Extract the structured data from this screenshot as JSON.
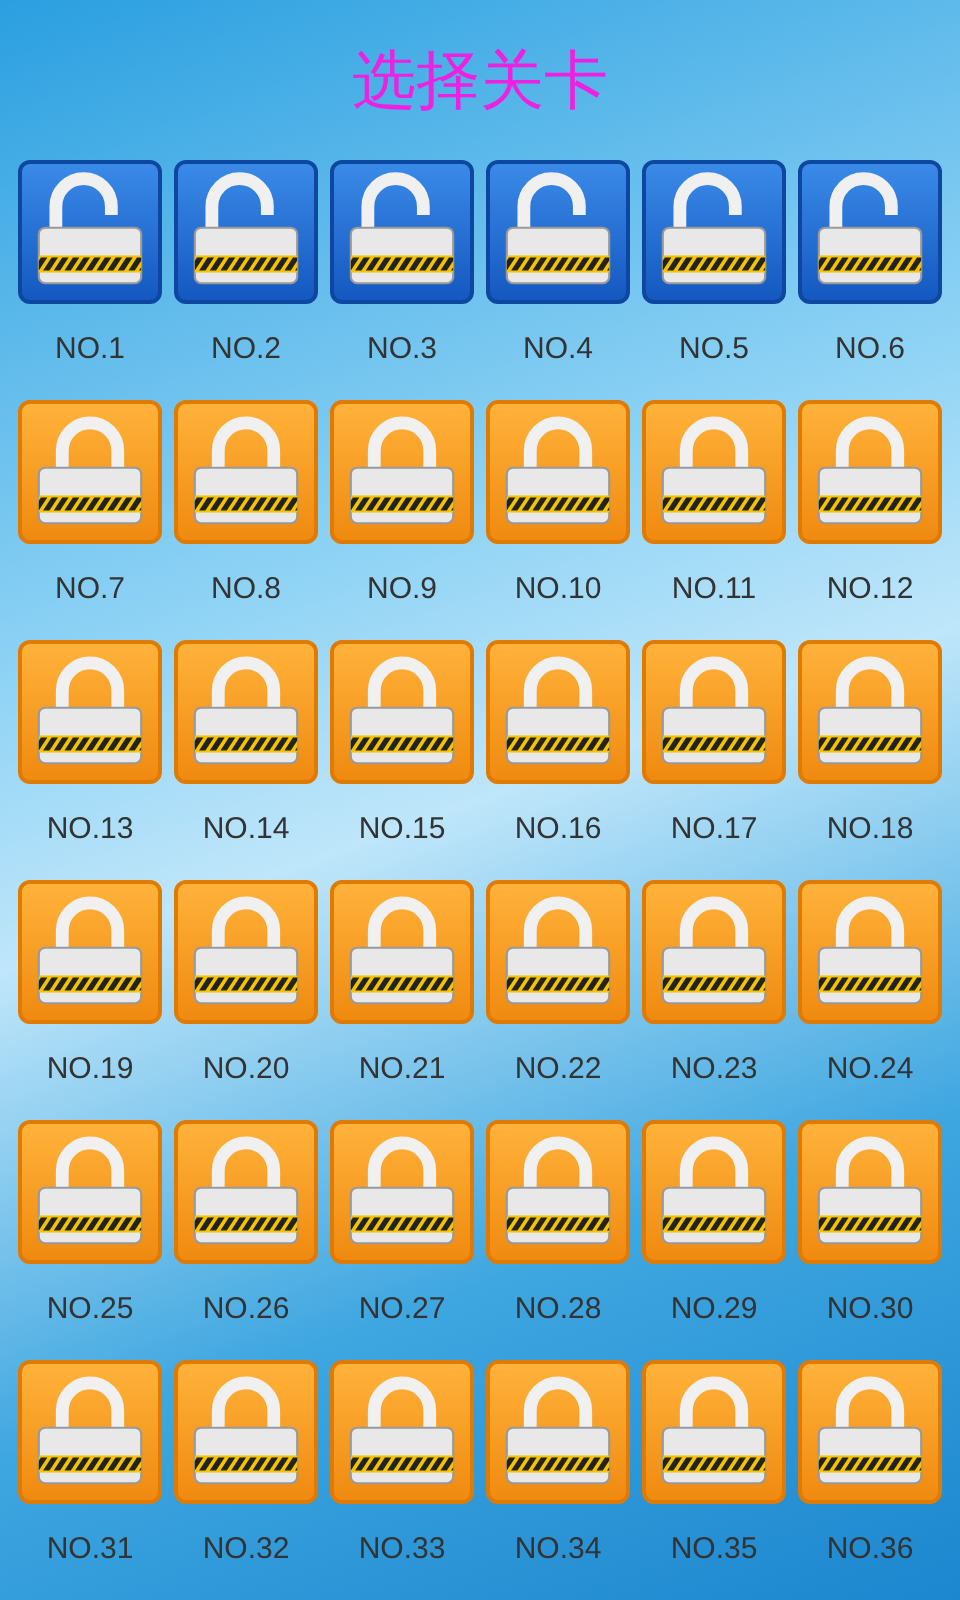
{
  "title": "选择关卡",
  "levels": [
    {
      "label": "NO.1",
      "locked": false
    },
    {
      "label": "NO.2",
      "locked": false
    },
    {
      "label": "NO.3",
      "locked": false
    },
    {
      "label": "NO.4",
      "locked": false
    },
    {
      "label": "NO.5",
      "locked": false
    },
    {
      "label": "NO.6",
      "locked": false
    },
    {
      "label": "NO.7",
      "locked": true
    },
    {
      "label": "NO.8",
      "locked": true
    },
    {
      "label": "NO.9",
      "locked": true
    },
    {
      "label": "NO.10",
      "locked": true
    },
    {
      "label": "NO.11",
      "locked": true
    },
    {
      "label": "NO.12",
      "locked": true
    },
    {
      "label": "NO.13",
      "locked": true
    },
    {
      "label": "NO.14",
      "locked": true
    },
    {
      "label": "NO.15",
      "locked": true
    },
    {
      "label": "NO.16",
      "locked": true
    },
    {
      "label": "NO.17",
      "locked": true
    },
    {
      "label": "NO.18",
      "locked": true
    },
    {
      "label": "NO.19",
      "locked": true
    },
    {
      "label": "NO.20",
      "locked": true
    },
    {
      "label": "NO.21",
      "locked": true
    },
    {
      "label": "NO.22",
      "locked": true
    },
    {
      "label": "NO.23",
      "locked": true
    },
    {
      "label": "NO.24",
      "locked": true
    },
    {
      "label": "NO.25",
      "locked": true
    },
    {
      "label": "NO.26",
      "locked": true
    },
    {
      "label": "NO.27",
      "locked": true
    },
    {
      "label": "NO.28",
      "locked": true
    },
    {
      "label": "NO.29",
      "locked": true
    },
    {
      "label": "NO.30",
      "locked": true
    },
    {
      "label": "NO.31",
      "locked": true
    },
    {
      "label": "NO.32",
      "locked": true
    },
    {
      "label": "NO.33",
      "locked": true
    },
    {
      "label": "NO.34",
      "locked": true
    },
    {
      "label": "NO.35",
      "locked": true
    },
    {
      "label": "NO.36",
      "locked": true
    }
  ]
}
